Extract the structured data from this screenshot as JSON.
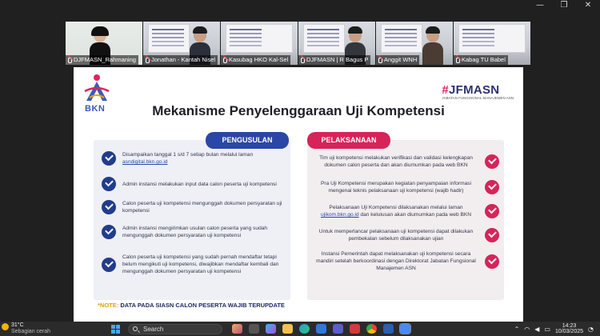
{
  "window_controls": {
    "minimize": "—",
    "restore": "❐",
    "close": "✕"
  },
  "participants": [
    {
      "name": "DJFMASN_Rahmaning",
      "active": true
    },
    {
      "name": "Jonathan - Kantah Nisel",
      "active": false
    },
    {
      "name": "Kasubag HKO Kal-Sel",
      "active": false
    },
    {
      "name": "DJFMASN | R Bagus P",
      "active": false
    },
    {
      "name": "Anggit WNH",
      "active": false
    },
    {
      "name": "Kabag TU Babel",
      "active": false
    }
  ],
  "slide": {
    "logo_text": "BKN",
    "brand": {
      "hash": "#",
      "name": "JFMASN",
      "tagline": "JABATAN FUNGSIONAL MANAJEMEN ASN"
    },
    "title": "Mekanisme Penyelenggaraan Uji Kompetensi",
    "left_tab": "PENGUSULAN",
    "right_tab": "PELAKSANAAN",
    "left_items": [
      {
        "text": "Disampaikan tanggal 1 s/d 7 setiap bulan melalui laman",
        "link": "asndigital.bkn.go.id"
      },
      {
        "text": "Admin instansi melakukan input data calon peserta uji kompetensi",
        "link": ""
      },
      {
        "text": "Calon peserta uji kompetensi mengunggah dokumen persyaratan uji kompetensi",
        "link": ""
      },
      {
        "text": "Admin instansi mengirimkan usulan calon peserta yang sudah mengunggah dokumen persyaratan uji kompetensi",
        "link": ""
      },
      {
        "text": "Calon peserta uji kompetensi yang sudah pernah mendaftar tetapi belum mengikuti uji kompetensi, diwajibkan mendaftar kembali dan mengunggah dokumen persyaratan uji kompetensi",
        "link": ""
      }
    ],
    "right_items": [
      {
        "text": "Tim uji kompetensi melakukan verifikasi dan validasi kelengkapan dokumen calon peserta dan akan diumumkan pada web BKN"
      },
      {
        "text": "Pra Uji Kompetensi merupakan kegiatan penyampaian informasi mengenai teknis pelaksanaan uji kompetensi (wajib hadir)"
      },
      {
        "text_before": "Pelaksanaan Uji Kompetensi dilaksanakan melalui laman",
        "link": "ujikom.bkn.go.id",
        "text_after": "dan kelulusan akan diumumkan pada web BKN"
      },
      {
        "text": "Untuk memperlancar pelaksanaan uji kompetensi dapat dilakukan pembekalan sebelum dilaksanakan ujian"
      },
      {
        "text": "Instansi Pemerintah dapat melaksanakan uji kompetensi secara mandiri setelah berkoordinasi dengan Direktorat Jabatan Fungsional Manajemen ASN"
      }
    ],
    "note_prefix": "*NOTE:",
    "note_text": "DATA PADA SIASN CALON PESERTA WAJIB TERUPDATE"
  },
  "taskbar": {
    "weather_temp": "31°C",
    "weather_cond": "Sebagian cerah",
    "search_placeholder": "Search",
    "time": "14:23",
    "date": "10/03/2025"
  },
  "colors": {
    "blue": "#2a47a6",
    "pink": "#d6245a",
    "navy": "#213c8d"
  }
}
